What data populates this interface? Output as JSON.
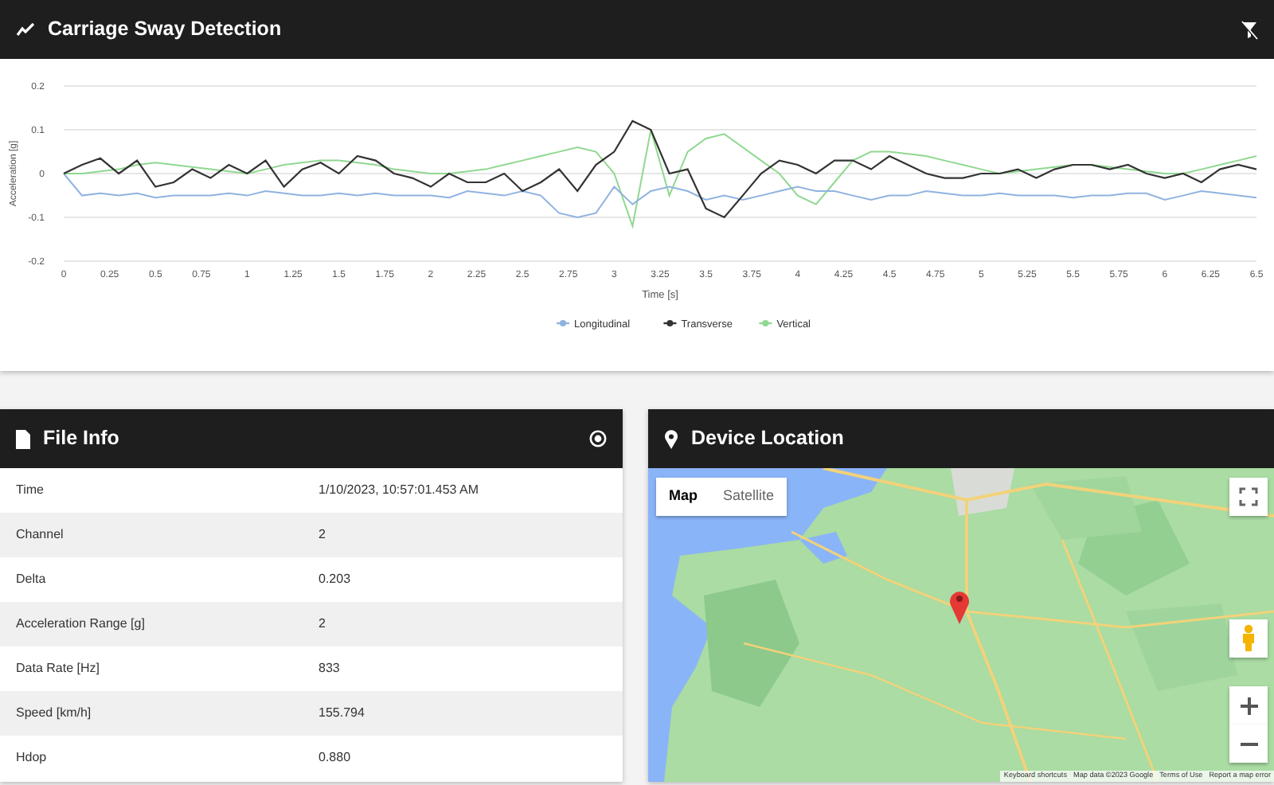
{
  "chart_panel": {
    "title": "Carriage Sway Detection",
    "chart_data": {
      "type": "line",
      "xlabel": "Time [s]",
      "ylabel": "Acceleration [g]",
      "x": [
        0,
        0.1,
        0.2,
        0.3,
        0.4,
        0.5,
        0.6,
        0.7,
        0.8,
        0.9,
        1,
        1.1,
        1.2,
        1.3,
        1.4,
        1.5,
        1.6,
        1.7,
        1.8,
        1.9,
        2,
        2.1,
        2.2,
        2.3,
        2.4,
        2.5,
        2.6,
        2.7,
        2.8,
        2.9,
        3,
        3.1,
        3.2,
        3.3,
        3.4,
        3.5,
        3.6,
        3.7,
        3.8,
        3.9,
        4,
        4.1,
        4.2,
        4.3,
        4.4,
        4.5,
        4.6,
        4.7,
        4.8,
        4.9,
        5,
        5.1,
        5.2,
        5.3,
        5.4,
        5.5,
        5.6,
        5.7,
        5.8,
        5.9,
        6,
        6.1,
        6.2,
        6.3,
        6.4,
        6.5
      ],
      "series": [
        {
          "name": "Longitudinal",
          "color": "#8fb3e0",
          "values": [
            0,
            -0.05,
            -0.045,
            -0.05,
            -0.045,
            -0.055,
            -0.05,
            -0.05,
            -0.05,
            -0.045,
            -0.05,
            -0.04,
            -0.045,
            -0.05,
            -0.05,
            -0.045,
            -0.05,
            -0.045,
            -0.05,
            -0.05,
            -0.05,
            -0.055,
            -0.04,
            -0.045,
            -0.05,
            -0.04,
            -0.05,
            -0.09,
            -0.1,
            -0.09,
            -0.03,
            -0.07,
            -0.04,
            -0.03,
            -0.04,
            -0.06,
            -0.05,
            -0.06,
            -0.05,
            -0.04,
            -0.03,
            -0.04,
            -0.04,
            -0.05,
            -0.06,
            -0.05,
            -0.05,
            -0.04,
            -0.045,
            -0.05,
            -0.05,
            -0.045,
            -0.05,
            -0.05,
            -0.05,
            -0.055,
            -0.05,
            -0.05,
            -0.045,
            -0.045,
            -0.06,
            -0.05,
            -0.04,
            -0.045,
            -0.05,
            -0.055
          ]
        },
        {
          "name": "Transverse",
          "color": "#333333",
          "values": [
            0,
            0.02,
            0.035,
            0.0,
            0.03,
            -0.03,
            -0.02,
            0.01,
            -0.01,
            0.02,
            0.0,
            0.03,
            -0.03,
            0.01,
            0.025,
            0.0,
            0.04,
            0.03,
            0.0,
            -0.01,
            -0.03,
            0.0,
            -0.02,
            -0.02,
            0.0,
            -0.04,
            -0.02,
            0.01,
            -0.04,
            0.02,
            0.05,
            0.12,
            0.1,
            0.0,
            0.01,
            -0.08,
            -0.1,
            -0.05,
            0.0,
            0.03,
            0.02,
            0.0,
            0.03,
            0.03,
            0.01,
            0.04,
            0.02,
            0.0,
            -0.01,
            -0.01,
            0.0,
            0.0,
            0.01,
            -0.01,
            0.01,
            0.02,
            0.02,
            0.01,
            0.02,
            0.0,
            -0.01,
            0.0,
            -0.02,
            0.01,
            0.02,
            0.01
          ]
        },
        {
          "name": "Vertical",
          "color": "#90d890",
          "values": [
            0,
            0,
            0.005,
            0.01,
            0.02,
            0.025,
            0.02,
            0.015,
            0.01,
            0.005,
            0,
            0.01,
            0.02,
            0.025,
            0.03,
            0.03,
            0.025,
            0.02,
            0.01,
            0.005,
            0,
            0,
            0.005,
            0.01,
            0.02,
            0.03,
            0.04,
            0.05,
            0.06,
            0.05,
            0.0,
            -0.12,
            0.1,
            -0.05,
            0.05,
            0.08,
            0.09,
            0.06,
            0.03,
            0.0,
            -0.05,
            -0.07,
            -0.02,
            0.03,
            0.05,
            0.05,
            0.045,
            0.04,
            0.03,
            0.02,
            0.01,
            0.0,
            0.005,
            0.01,
            0.015,
            0.02,
            0.02,
            0.015,
            0.01,
            0.005,
            0.0,
            0.0,
            0.01,
            0.02,
            0.03,
            0.04
          ]
        }
      ],
      "xlim": [
        0,
        6.5
      ],
      "ylim": [
        -0.2,
        0.2
      ],
      "xticks": [
        0,
        0.25,
        0.5,
        0.75,
        1,
        1.25,
        1.5,
        1.75,
        2,
        2.25,
        2.5,
        2.75,
        3,
        3.25,
        3.5,
        3.75,
        4,
        4.25,
        4.5,
        4.75,
        5,
        5.25,
        5.5,
        5.75,
        6,
        6.25,
        6.5
      ],
      "yticks": [
        -0.2,
        -0.1,
        0,
        0.1,
        0.2
      ],
      "grid": "y",
      "legend": "bottom"
    }
  },
  "file_info": {
    "title": "File Info",
    "rows": [
      {
        "label": "Time",
        "value": "1/10/2023, 10:57:01.453 AM"
      },
      {
        "label": "Channel",
        "value": "2"
      },
      {
        "label": "Delta",
        "value": "0.203"
      },
      {
        "label": "Acceleration Range [g]",
        "value": "2"
      },
      {
        "label": "Data Rate [Hz]",
        "value": "833"
      },
      {
        "label": "Speed [km/h]",
        "value": "155.794"
      },
      {
        "label": "Hdop",
        "value": "0.880"
      }
    ]
  },
  "device_location": {
    "title": "Device Location",
    "map_types": [
      {
        "label": "Map",
        "selected": true
      },
      {
        "label": "Satellite",
        "selected": false
      }
    ],
    "attribution": [
      "Keyboard shortcuts",
      "Map data ©2023 Google",
      "Terms of Use",
      "Report a map error"
    ]
  }
}
